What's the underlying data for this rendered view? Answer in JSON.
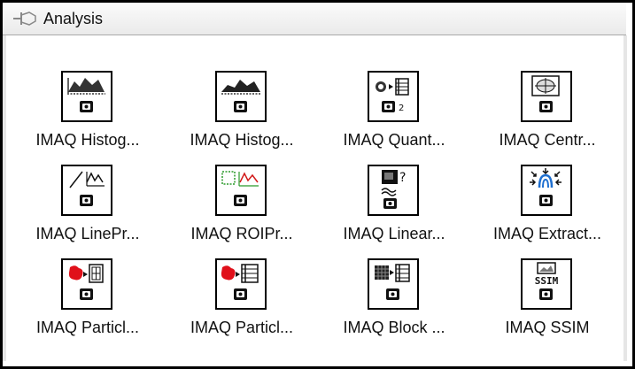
{
  "palette": {
    "title": "Analysis",
    "pin_icon": "pin-icon",
    "items": [
      {
        "label": "IMAQ Histog...",
        "icon": "histogram-icon"
      },
      {
        "label": "IMAQ Histog...",
        "icon": "histograph-icon"
      },
      {
        "label": "IMAQ Quant...",
        "icon": "quantify-icon",
        "badge": "2"
      },
      {
        "label": "IMAQ Centr...",
        "icon": "centroid-icon"
      },
      {
        "label": "IMAQ LinePr...",
        "icon": "line-profile-icon"
      },
      {
        "label": "IMAQ ROIPr...",
        "icon": "roi-profile-icon"
      },
      {
        "label": "IMAQ Linear...",
        "icon": "linear-averages-icon"
      },
      {
        "label": "IMAQ Extract...",
        "icon": "extract-icon"
      },
      {
        "label": "IMAQ Particl...",
        "icon": "particle-analysis-report-icon"
      },
      {
        "label": "IMAQ Particl...",
        "icon": "particle-analysis-icon"
      },
      {
        "label": "IMAQ Block ...",
        "icon": "block-mean-icon"
      },
      {
        "label": "IMAQ SSIM",
        "icon": "ssim-icon",
        "badge": "SSIM"
      }
    ]
  }
}
